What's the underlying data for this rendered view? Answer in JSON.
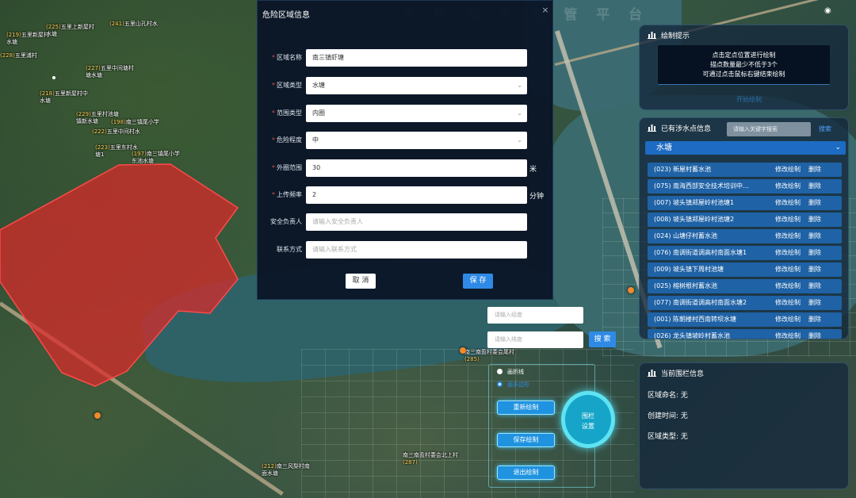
{
  "top_title": "头 区 学 生 防 溺 水 监 管 平 台",
  "modal": {
    "title": "危险区域信息",
    "fields": [
      {
        "label": "区域名称",
        "required": true,
        "value": "南三镇虾塘",
        "placeholder": ""
      },
      {
        "label": "区域类型",
        "required": true,
        "value": "水塘",
        "placeholder": ""
      },
      {
        "label": "范围类型",
        "required": true,
        "value": "内圈",
        "placeholder": ""
      },
      {
        "label": "危险程度",
        "required": true,
        "value": "中",
        "placeholder": ""
      },
      {
        "label": "外圈范围",
        "required": true,
        "value": "30",
        "placeholder": "",
        "unit": "米"
      },
      {
        "label": "上传频率",
        "required": true,
        "value": "2",
        "placeholder": "",
        "unit": "分钟"
      },
      {
        "label": "安全负责人",
        "required": false,
        "value": "",
        "placeholder": "请输入安全负责人"
      },
      {
        "label": "联系方式",
        "required": false,
        "value": "",
        "placeholder": "请输入联系方式"
      }
    ],
    "cancel_label": "取 消",
    "save_label": "保 存",
    "close_glyph": "×"
  },
  "hint_panel": {
    "title": "绘制提示",
    "lines": [
      "点击定点位置进行绘制",
      "描点数量最少不低于3个",
      "可通过点击鼠标右键结束绘制"
    ],
    "draw_label": "开始绘制"
  },
  "list_panel": {
    "title": "已有涉水点信息",
    "keyword_placeholder": "请输入关键字搜索",
    "search_label": "搜索",
    "type_selected": "水塘",
    "edit_label": "修改绘制",
    "delete_label": "删除",
    "items": [
      "(023) 新屋村蓄水池",
      "(075) 南海西部安全技术培训中...",
      "(007) 坡头镇郑屋岭村池塘1",
      "(008) 坡头镇郑屋岭村池塘2",
      "(024) 山塘仔村蓄水池",
      "(076) 南调街道调高村南面水塘1",
      "(009) 坡头镇下周村池塘",
      "(025) 榕树根村蓄水池",
      "(077) 南调街道调高村南面水塘2",
      "(001) 陈朝楼村西南转坝水塘",
      "(026) 龙头镇坡岭村蓄水池"
    ]
  },
  "fence_panel": {
    "title": "当前围栏信息",
    "name_label": "区域命名:",
    "name_value": "无",
    "time_label": "创建时间:",
    "time_value": "无",
    "type_label": "区域类型:",
    "type_value": "无"
  },
  "coord_search": {
    "lng_placeholder": "请输入经度",
    "lat_placeholder": "请输入纬度",
    "search_label": "搜 索"
  },
  "draw_tools": {
    "mode_polyline": "画折线",
    "mode_polygon": "画多边形",
    "selected_mode": "polygon",
    "redraw_label": "重新绘制",
    "save_label": "保存绘制",
    "exit_label": "退出绘制",
    "fence_line1": "围栏",
    "fence_line2": "设置"
  },
  "map_labels": [
    {
      "num": "(219)",
      "text": "五里新屋村",
      "sub": "水塘"
    },
    {
      "num": "(225)",
      "text": "五里上新屋村",
      "sub": "水塘"
    },
    {
      "num": "(241)",
      "text": "五里山孔村水",
      "sub": ""
    },
    {
      "num": "(228)",
      "text": "五里浦村",
      "sub": ""
    },
    {
      "num": "(227)",
      "text": "五里中间塘村",
      "sub": "塘水塘"
    },
    {
      "num": "(218)",
      "text": "五里新屋村中",
      "sub": "水塘"
    },
    {
      "num": "(229)",
      "text": "五里村池塘",
      "sub": "镇新水塘"
    },
    {
      "num": "(198)",
      "text": "南三镇尾小学",
      "sub": ""
    },
    {
      "num": "(222)",
      "text": "五里中间村水",
      "sub": ""
    },
    {
      "num": "(223)",
      "text": "五里东村水",
      "sub": "塘1"
    },
    {
      "num": "(197)",
      "text": "南三镇尾小学",
      "sub": "东池水塘"
    },
    {
      "num": "(212)",
      "text": "南三风梨村南",
      "sub": "面水塘"
    },
    {
      "num": "(285)",
      "text": "南三南盈村委会尾村",
      "sub": ""
    },
    {
      "num": "(287)",
      "text": "南三南盈村委会北上村",
      "sub": ""
    }
  ]
}
